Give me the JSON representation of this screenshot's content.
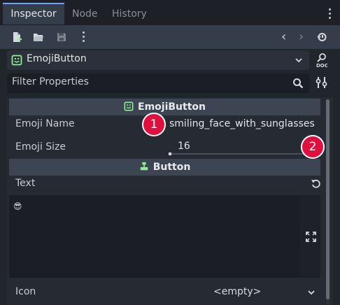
{
  "tabs": [
    {
      "label": "Inspector",
      "active": true
    },
    {
      "label": "Node",
      "active": false
    },
    {
      "label": "History",
      "active": false
    }
  ],
  "toolbar": {
    "icons": [
      "new-resource-icon",
      "open-folder-icon",
      "save-icon",
      "more-options-icon",
      "back-icon",
      "forward-icon",
      "history-icon"
    ]
  },
  "object_selector": {
    "name": "EmojiButton",
    "icon": "custom-button-icon"
  },
  "filter": {
    "placeholder": "Filter Properties"
  },
  "sections": {
    "emoji_button": {
      "title": "EmojiButton",
      "icon": "custom-button-icon"
    },
    "button": {
      "title": "Button",
      "icon": "button-icon"
    }
  },
  "properties": {
    "emoji_name": {
      "label": "Emoji Name",
      "value": "smiling_face_with_sunglasses"
    },
    "emoji_size": {
      "label": "Emoji Size",
      "value": "16"
    },
    "text": {
      "label": "Text",
      "value": "😎"
    },
    "icon": {
      "label": "Icon",
      "value": "<empty>"
    }
  },
  "callouts": [
    "1",
    "2"
  ],
  "colors": {
    "accent": "#6fa0ff",
    "badge": "#e0103e",
    "script_green": "#8eef97"
  }
}
